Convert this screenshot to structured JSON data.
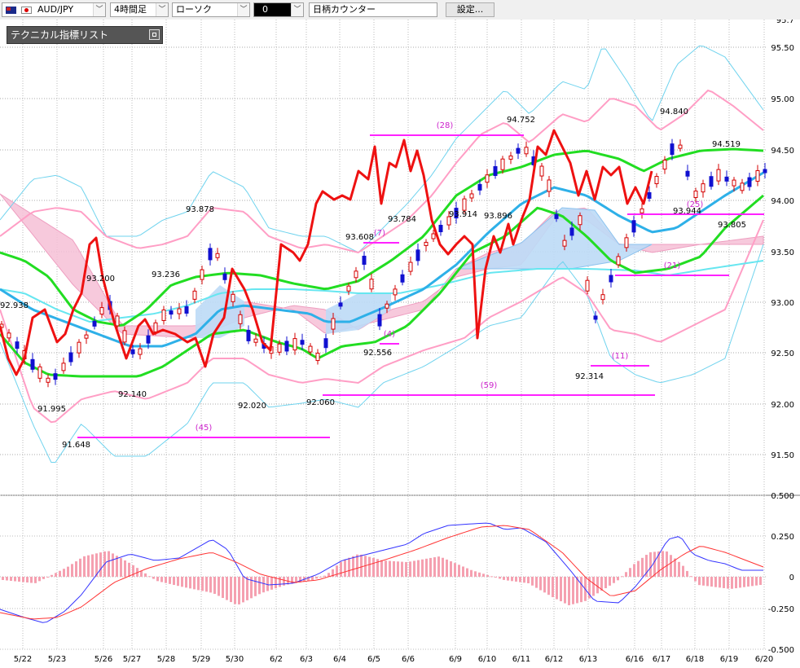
{
  "toolbar": {
    "symbol": "AUD/JPY",
    "timeframe": "4時間足",
    "chart_type": "ローソク",
    "counter_value": "0",
    "counter_label": "日柄カウンター",
    "settings_label": "設定..."
  },
  "indicator_panel": {
    "title": "テクニカル指標リスト"
  },
  "price_axis": {
    "labels": [
      "95.50",
      "95.00",
      "94.50",
      "94.00",
      "93.50",
      "93.00",
      "92.50",
      "92.00",
      "91.50"
    ]
  },
  "macd_axis": {
    "labels": [
      "0.500",
      "0.250",
      "0",
      "-0.250",
      "-0.500"
    ]
  },
  "date_labels": [
    "5/22",
    "5/23",
    "5/26",
    "5/27",
    "5/28",
    "5/29",
    "5/30",
    "6/2",
    "6/3",
    "6/4",
    "6/5",
    "6/6",
    "6/9",
    "6/10",
    "6/11",
    "6/12",
    "6/13",
    "6/16",
    "6/17",
    "6/18",
    "6/19",
    "6/20"
  ],
  "price_annotations": [
    "92.938",
    "91.995",
    "91.648",
    "93.200",
    "92.140",
    "93.236",
    "93.878",
    "92.020",
    "92.060",
    "93.608",
    "92.556",
    "93.784",
    "93.914",
    "93.896",
    "94.752",
    "92.314",
    "94.840",
    "93.944",
    "94.519",
    "93.805"
  ],
  "span_counts": [
    "(45)",
    "(59)",
    "(28)",
    "(7)",
    "(4)",
    "(11)",
    "(21)",
    "(25)"
  ],
  "colors": {
    "bull_candle": "#d40000",
    "bear_candle": "#1010d0",
    "kumo_fill": "#f6c0d6",
    "kumo_fill_bear": "#bcdaf6",
    "bollinger_outer": "#6fd3ee",
    "bollinger_inner": "#ff9ec5",
    "ma_green": "#22dd22",
    "ma_blue": "#2eb0e8",
    "ma_cyan": "#66e6f0",
    "chikou_red": "#ee1111",
    "count_line": "#ff22ff",
    "macd_line": "#3333ff",
    "signal_line": "#ff3333",
    "histogram": "#f5a0b0"
  }
}
